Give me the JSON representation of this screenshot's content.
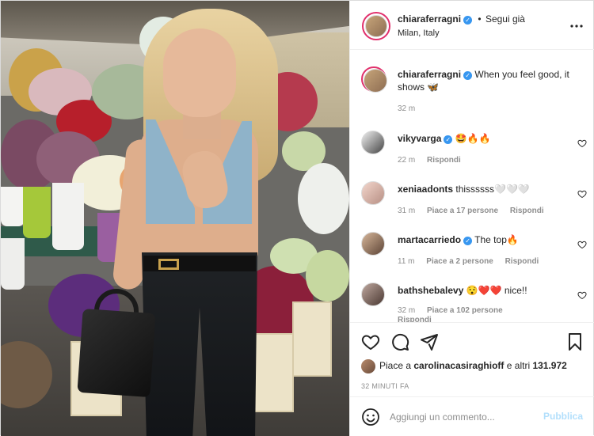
{
  "header": {
    "username": "chiaraferragni",
    "separator": "•",
    "follow_label": "Segui già",
    "location": "Milan, Italy",
    "more_icon": "more-horizontal-icon"
  },
  "caption": {
    "username": "chiaraferragni",
    "text": "When you feel good, it shows 🦋",
    "time": "32 m"
  },
  "comments": [
    {
      "username": "vikyvarga",
      "verified": true,
      "text": "🤩🔥🔥",
      "time": "22 m",
      "likes": "",
      "reply": "Rispondi"
    },
    {
      "username": "xeniaadonts",
      "verified": false,
      "text": "thissssss🤍🤍🤍",
      "time": "31 m",
      "likes": "Piace a 17 persone",
      "reply": "Rispondi"
    },
    {
      "username": "martacarriedo",
      "verified": true,
      "text": "The top🔥",
      "time": "11 m",
      "likes": "Piace a 2 persone",
      "reply": "Rispondi"
    },
    {
      "username": "bathshebalevy",
      "verified": false,
      "text": "😯❤️❤️ nice!!",
      "time": "32 m",
      "likes": "Piace a 102 persone",
      "reply": "Rispondi"
    }
  ],
  "actions": {
    "icons": [
      "heart-icon",
      "comment-icon",
      "share-icon",
      "bookmark-icon"
    ],
    "likes_prefix": "Piace a",
    "likes_user": "carolinacasiraghioff",
    "likes_suffix": "e altri",
    "likes_count": "131.972",
    "timestamp": "32 MINUTI FA"
  },
  "composer": {
    "placeholder": "Aggiungi un commento...",
    "publish_label": "Pubblica"
  },
  "colors": {
    "accent": "#3897f0",
    "publish_disabled": "#b2dffc",
    "muted": "#8e8e8e",
    "text": "#262626"
  }
}
